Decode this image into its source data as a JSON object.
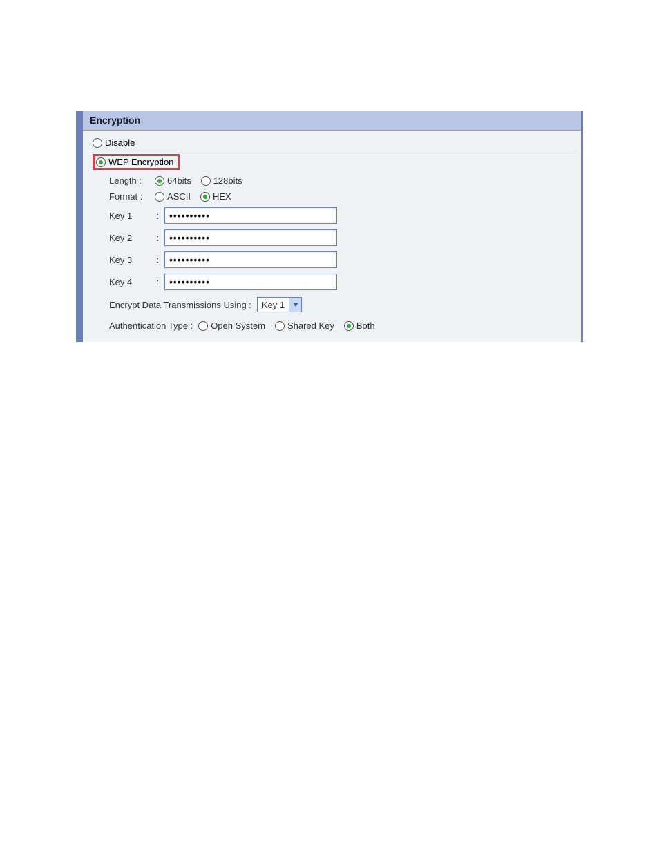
{
  "panel": {
    "title": "Encryption"
  },
  "options": {
    "disable_label": "Disable",
    "wep_label": "WEP Encryption",
    "selected": "wep"
  },
  "length": {
    "label": "Length :",
    "opt64": "64bits",
    "opt128": "128bits",
    "selected": "64"
  },
  "format": {
    "label": "Format :",
    "ascii": "ASCII",
    "hex": "HEX",
    "selected": "hex"
  },
  "keys": {
    "key1_label": "Key 1",
    "key2_label": "Key 2",
    "key3_label": "Key 3",
    "key4_label": "Key 4",
    "key1_value": "••••••••••",
    "key2_value": "••••••••••",
    "key3_value": "••••••••••",
    "key4_value": "••••••••••"
  },
  "encrypt_using": {
    "label": "Encrypt Data Transmissions Using  :",
    "value": "Key 1"
  },
  "auth": {
    "label": "Authentication Type  :",
    "open": "Open System",
    "shared": "Shared Key",
    "both": "Both",
    "selected": "both"
  }
}
